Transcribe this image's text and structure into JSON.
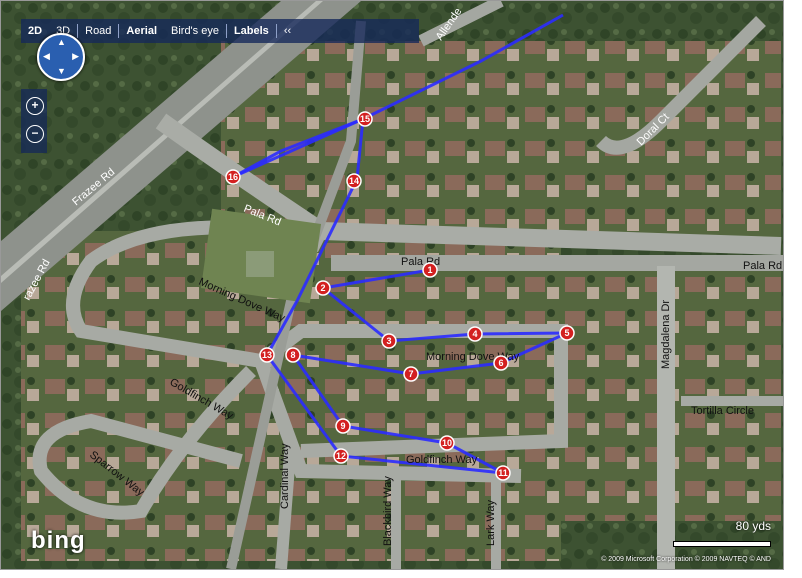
{
  "toolbar": {
    "items": [
      "2D",
      "3D",
      "Road",
      "Aerial",
      "Bird's eye",
      "Labels",
      "‹‹"
    ],
    "active": "Aerial"
  },
  "zoom": {
    "in": "+",
    "out": "−"
  },
  "streets": {
    "frazee1": "Frazee Rd",
    "frazee2": "razee Rd",
    "allende": "Allende",
    "doral": "Doral Ct",
    "pala1": "Pala Rd",
    "pala2": "Pala Rd",
    "pala3": "Pala Rd",
    "morning_dove1": "Morning Dove Way",
    "morning_dove2": "Morning Dove Way",
    "goldfinch1": "Goldfinch Way",
    "goldfinch2": "Goldfinch Way",
    "sparrow": "Sparrow Way",
    "cardinal": "Cardinal Way",
    "blackbird": "Blackbird Way",
    "lark": "Lark Way",
    "magdalena": "Magdalena Dr",
    "tortilla": "Tortilla Circle"
  },
  "waypoints": [
    "1",
    "2",
    "3",
    "4",
    "5",
    "6",
    "7",
    "8",
    "9",
    "10",
    "11",
    "12",
    "13",
    "14",
    "15",
    "16"
  ],
  "route_color": "#2b2bff",
  "scale": {
    "label": "80 yds"
  },
  "copyright": "© 2009 Microsoft Corporation   © 2009 NAVTEQ   © AND",
  "logo": "bing"
}
